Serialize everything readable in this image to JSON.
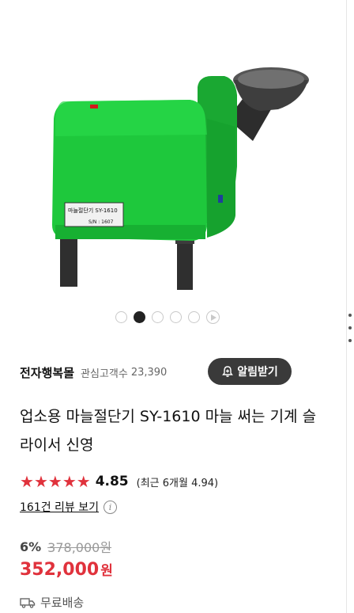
{
  "product_image": {
    "label_plate_title": "마늘절단기 SY-1610",
    "label_plate_serial": "S/N : 1607"
  },
  "gallery": {
    "dot_count": 5,
    "active_index": 1
  },
  "seller": {
    "name": "전자행복몰",
    "follower_label": "관심고객수",
    "follower_count": "23,390",
    "alarm_button": "알림받기"
  },
  "product": {
    "title": "업소용 마늘절단기 SY-1610 마늘 써는 기계 슬라이서 신영"
  },
  "rating": {
    "stars": 5,
    "value": "4.85",
    "recent": "(최근 6개월 4.94)"
  },
  "reviews": {
    "link": "161건 리뷰 보기",
    "info_icon": "i"
  },
  "price": {
    "discount": "6%",
    "original": "378,000원",
    "current": "352,000",
    "currency": "원"
  },
  "shipping": {
    "label": "무료배송"
  },
  "colors": {
    "accent_red": "#e0323c",
    "machine_green": "#1ec83c",
    "button_dark": "#3a3a3a"
  }
}
